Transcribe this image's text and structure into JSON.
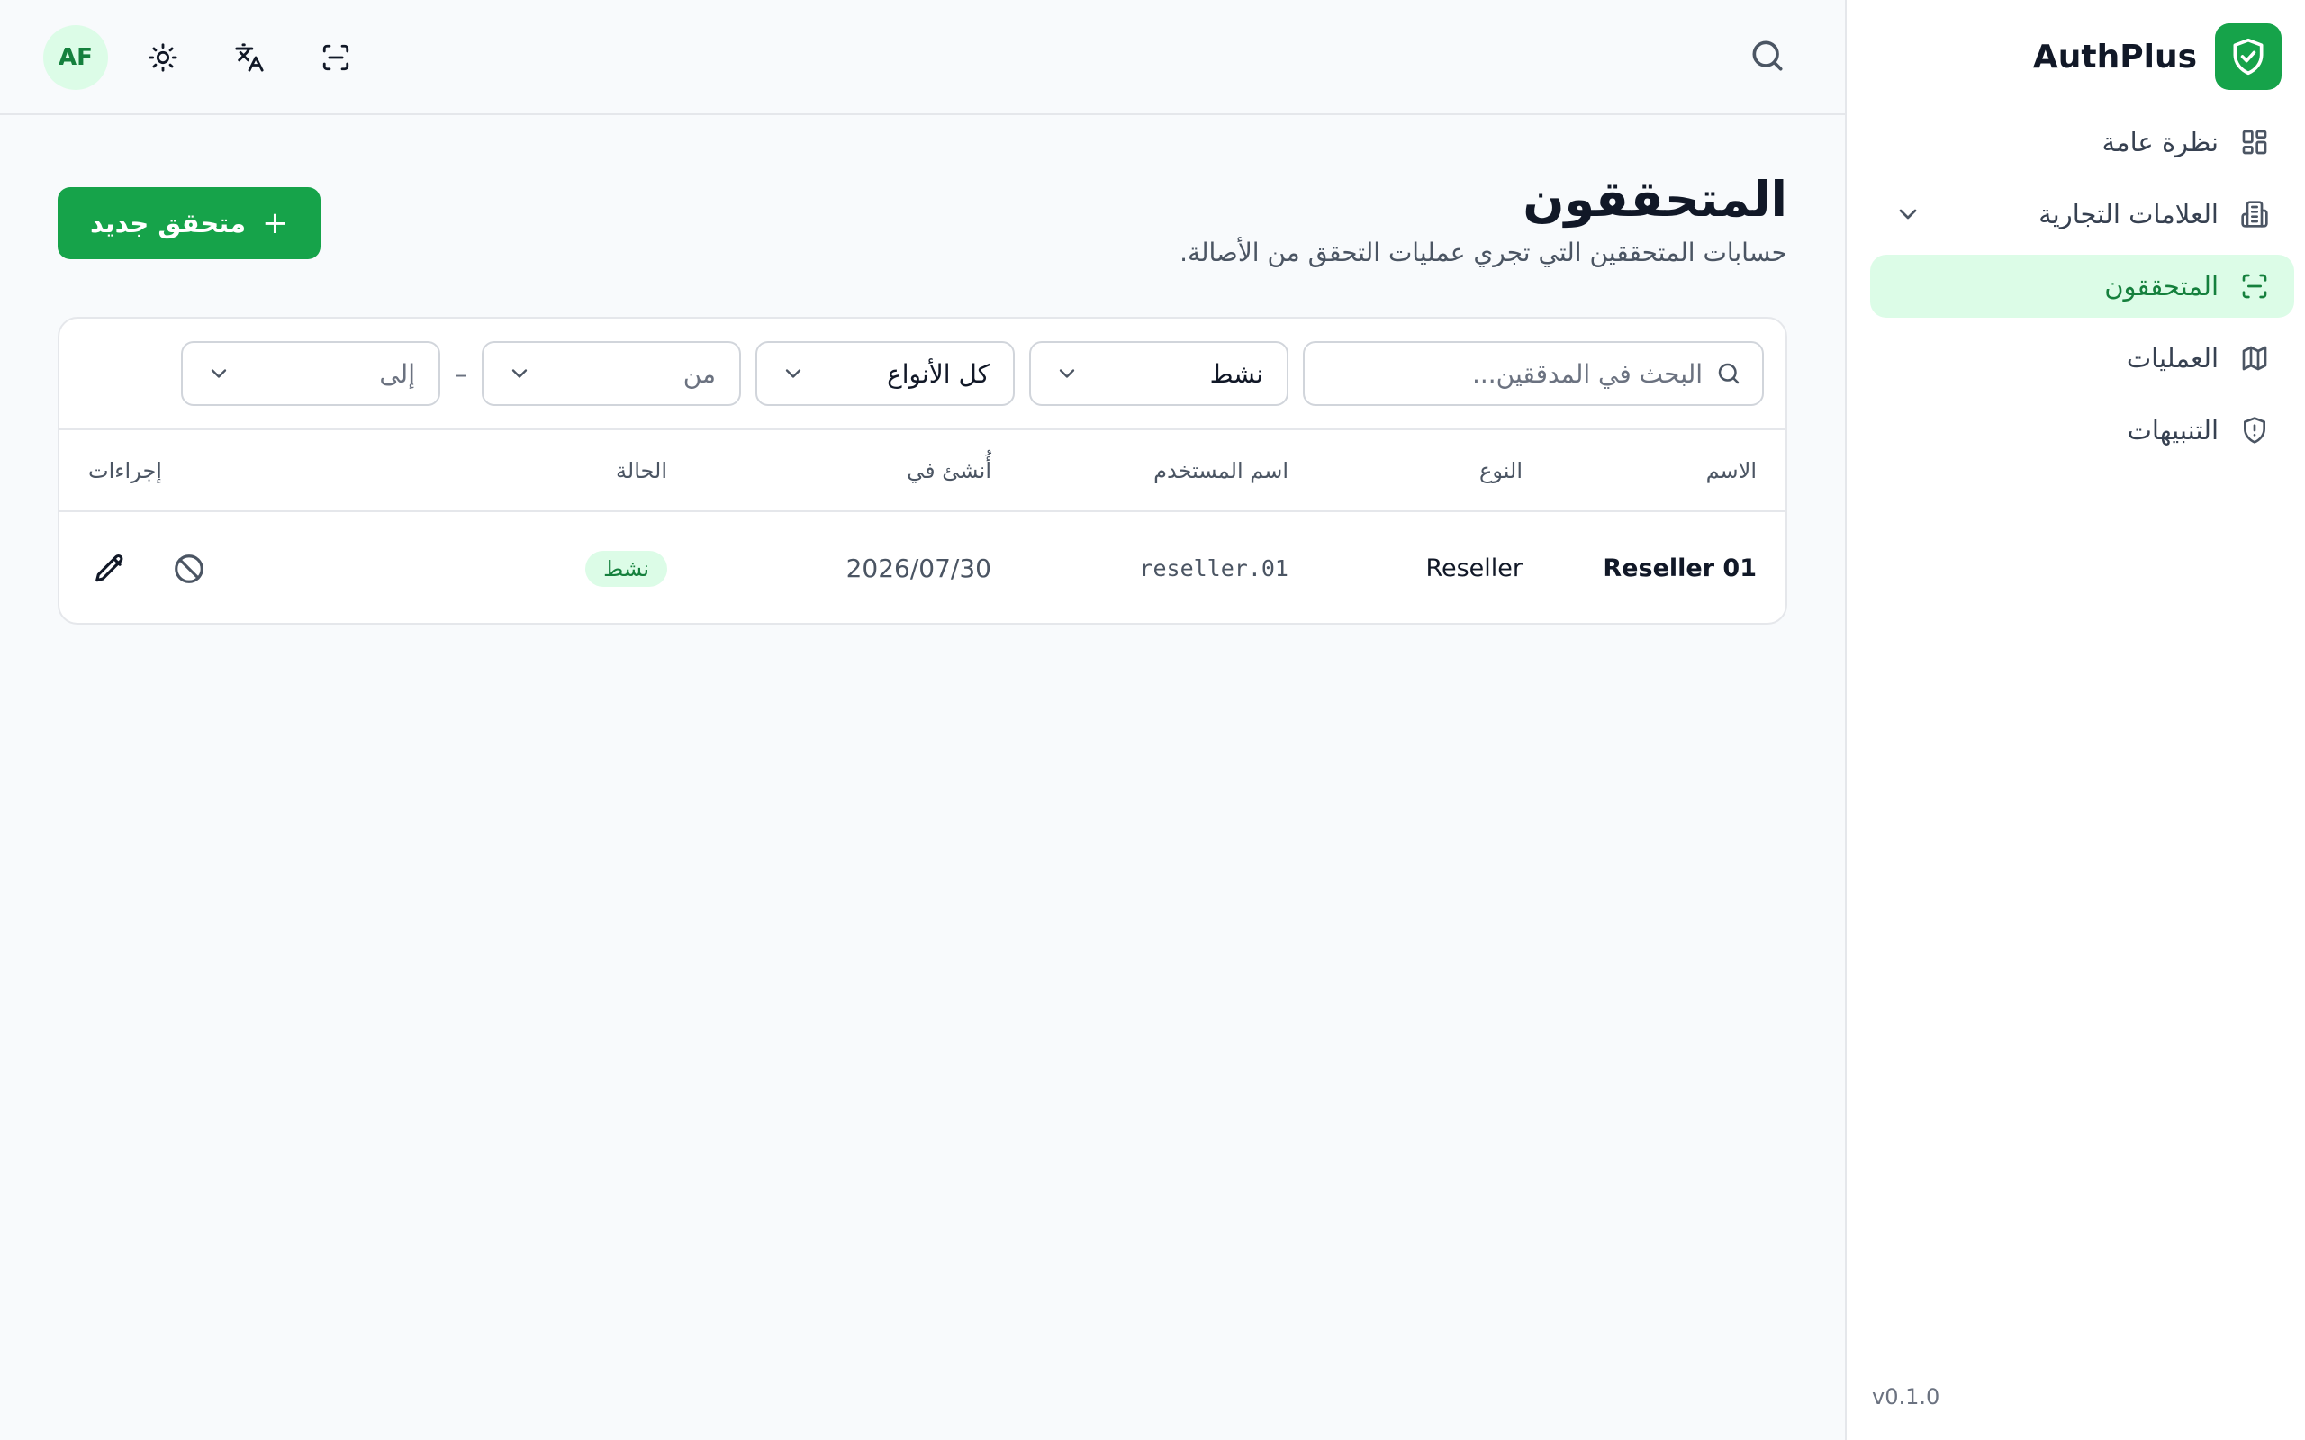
{
  "app": {
    "name": "AuthPlus",
    "version": "v0.1.0",
    "accent": "#16a34a",
    "logo_icon": "shield-check-icon"
  },
  "sidebar": {
    "items": [
      {
        "label": "نظرة عامة",
        "icon": "dashboard-grid-icon",
        "active": false
      },
      {
        "label": "العلامات التجارية",
        "icon": "building-icon",
        "active": false,
        "expandable": true
      },
      {
        "label": "المتحققون",
        "icon": "scan-icon",
        "active": true
      },
      {
        "label": "العمليات",
        "icon": "map-icon",
        "active": false
      },
      {
        "label": "التنبيهات",
        "icon": "shield-alert-icon",
        "active": false
      }
    ]
  },
  "topbar": {
    "avatar_initials": "AF",
    "icons": [
      "sun-icon",
      "translate-icon",
      "scan-icon",
      "search-icon"
    ]
  },
  "page": {
    "title": "المتحققون",
    "subtitle": "حسابات المتحققين التي تجري عمليات التحقق من الأصالة.",
    "new_button_label": "متحقق جديد",
    "new_button_icon": "plus"
  },
  "filters": {
    "search_placeholder": "البحث في المدققين...",
    "status_value": "نشط",
    "type_value": "كل الأنواع",
    "from_placeholder": "من",
    "range_separator": "–",
    "to_placeholder": "إلى"
  },
  "table": {
    "headers": {
      "name": "الاسم",
      "type": "النوع",
      "username": "اسم المستخدم",
      "created_at": "أُنشئ في",
      "status": "الحالة",
      "actions": "إجراءات"
    },
    "rows": [
      {
        "name": "Reseller 01",
        "type": "Reseller",
        "username": "reseller.01",
        "created_at": "2026/07/30",
        "status": "نشط",
        "actions": [
          "disable-icon",
          "edit-pencil-icon"
        ]
      }
    ]
  }
}
